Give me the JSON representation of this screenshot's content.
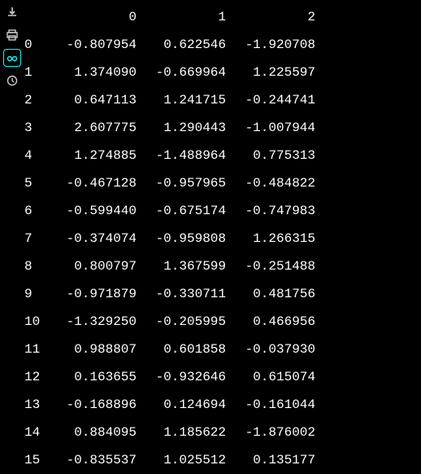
{
  "chart_data": {
    "type": "table",
    "columns": [
      "0",
      "1",
      "2"
    ],
    "index": [
      "0",
      "1",
      "2",
      "3",
      "4",
      "5",
      "6",
      "7",
      "8",
      "9",
      "10",
      "11",
      "12",
      "13",
      "14",
      "15"
    ],
    "rows": [
      [
        "-0.807954",
        "0.622546",
        "-1.920708"
      ],
      [
        "1.374090",
        "-0.669964",
        "1.225597"
      ],
      [
        "0.647113",
        "1.241715",
        "-0.244741"
      ],
      [
        "2.607775",
        "1.290443",
        "-1.007944"
      ],
      [
        "1.274885",
        "-1.488964",
        "0.775313"
      ],
      [
        "-0.467128",
        "-0.957965",
        "-0.484822"
      ],
      [
        "-0.599440",
        "-0.675174",
        "-0.747983"
      ],
      [
        "-0.374074",
        "-0.959808",
        "1.266315"
      ],
      [
        "0.800797",
        "1.367599",
        "-0.251488"
      ],
      [
        "-0.971879",
        "-0.330711",
        "0.481756"
      ],
      [
        "-1.329250",
        "-0.205995",
        "0.466956"
      ],
      [
        "0.988807",
        "0.601858",
        "-0.037930"
      ],
      [
        "0.163655",
        "-0.932646",
        "0.615074"
      ],
      [
        "-0.168896",
        "0.124694",
        "-0.161044"
      ],
      [
        "0.884095",
        "1.185622",
        "-1.876002"
      ],
      [
        "-0.835537",
        "1.025512",
        "0.135177"
      ]
    ]
  },
  "toolbar": {
    "items": [
      "download-icon",
      "print-icon",
      "glasses-icon",
      "history-icon"
    ]
  }
}
